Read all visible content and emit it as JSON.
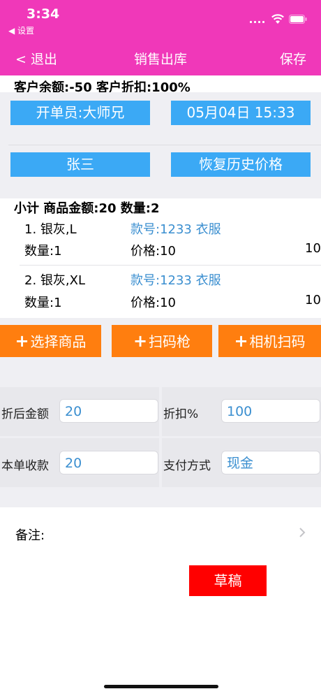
{
  "status_bar": {
    "time": "3:34",
    "back_label": "◀ 设置"
  },
  "nav": {
    "back": "< 退出",
    "title": "销售出库",
    "save": "保存"
  },
  "customer_info": "客户余额:-50 客户折扣:100%",
  "buttons": {
    "operator": "开单员:大师兄",
    "datetime": "05月04日 15:33",
    "customer": "张三",
    "restore_price": "恢复历史价格"
  },
  "subtotal": "小计 商品金额:20  数量:2",
  "items": [
    {
      "name": "1. 银灰,L",
      "code": "款号:1233  衣服",
      "qty": "数量:1",
      "price": "价格:10",
      "amount": "10"
    },
    {
      "name": "2. 银灰,XL",
      "code": "款号:1233  衣服",
      "qty": "数量:1",
      "price": "价格:10",
      "amount": "10"
    }
  ],
  "actions": {
    "plus": "+",
    "select_goods": "选择商品",
    "scanner": "扫码枪",
    "camera_scan": "相机扫码"
  },
  "form": {
    "discounted_label": "折后金额",
    "discounted_value": "20",
    "discount_label": "折扣%",
    "discount_value": "100",
    "received_label": "本单收款",
    "received_value": "20",
    "payment_label": "支付方式",
    "payment_value": "现金"
  },
  "remark_label": "备注:",
  "draft": "草稿",
  "colors": {
    "header": "#f038b9",
    "blue_button": "#3ba9f5",
    "orange_button": "#ff7e0f",
    "draft": "#ff0000"
  },
  "icons": [
    "wifi-icon",
    "battery-icon",
    "chevron-right-icon"
  ]
}
